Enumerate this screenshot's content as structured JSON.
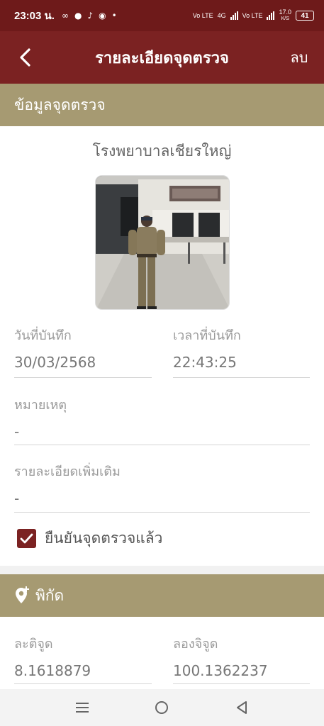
{
  "status_bar": {
    "time": "23:03 น.",
    "net_speed": "17.0",
    "net_unit": "K/S",
    "battery": "41",
    "network_1": "Vo LTE",
    "network_type": "4G",
    "network_2": "Vo LTE"
  },
  "app_bar": {
    "title": "รายละเอียดจุดตรวจ",
    "delete_label": "ลบ"
  },
  "checkpoint_section": {
    "header": "ข้อมูลจุดตรวจ",
    "place_name": "โรงพยาบาลเชียรใหญ่",
    "date_label": "วันที่บันทึก",
    "date_value": "30/03/2568",
    "time_label": "เวลาที่บันทึก",
    "time_value": "22:43:25",
    "note_label": "หมายเหตุ",
    "note_value": "-",
    "details_label": "รายละเอียดเพิ่มเติม",
    "details_value": "-",
    "confirm_label": "ยืนยันจุดตรวจแล้ว",
    "confirmed": true
  },
  "location_section": {
    "header": "พิกัด",
    "lat_label": "ละติจูด",
    "lat_value": "8.1618879",
    "lng_label": "ลองจิจูด",
    "lng_value": "100.1362237"
  },
  "nav_bar": {
    "items": [
      "recent-apps-icon",
      "home-icon",
      "back-icon"
    ]
  },
  "colors": {
    "status_bar": "#6e1a1a",
    "app_bar": "#7b2222",
    "section_header": "#a69a72"
  }
}
